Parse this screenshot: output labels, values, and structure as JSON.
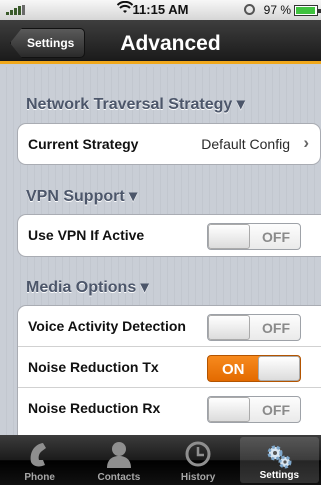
{
  "status_bar": {
    "time": "11:15 AM",
    "battery_percent": "97 %",
    "battery_level": 0.97
  },
  "nav": {
    "back_label": "Settings",
    "title": "Advanced"
  },
  "sections": {
    "network": {
      "header": "Network Traversal Strategy ▾",
      "current_strategy_label": "Current Strategy",
      "current_strategy_value": "Default Config"
    },
    "vpn": {
      "header": "VPN Support ▾",
      "use_vpn_label": "Use VPN If Active",
      "use_vpn_state": "OFF"
    },
    "media": {
      "header": "Media Options ▾",
      "vad_label": "Voice Activity Detection",
      "vad_state": "OFF",
      "nr_tx_label": "Noise Reduction Tx",
      "nr_tx_state": "ON",
      "nr_rx_label": "Noise Reduction Rx",
      "nr_rx_state": "OFF"
    }
  },
  "tabs": [
    {
      "label": "Phone",
      "icon": "phone-icon"
    },
    {
      "label": "Contacts",
      "icon": "contacts-icon"
    },
    {
      "label": "History",
      "icon": "clock-icon"
    },
    {
      "label": "Settings",
      "icon": "gears-icon",
      "active": true
    }
  ],
  "colors": {
    "accent": "#f0a81c",
    "toggle_on": "#f07a10"
  }
}
